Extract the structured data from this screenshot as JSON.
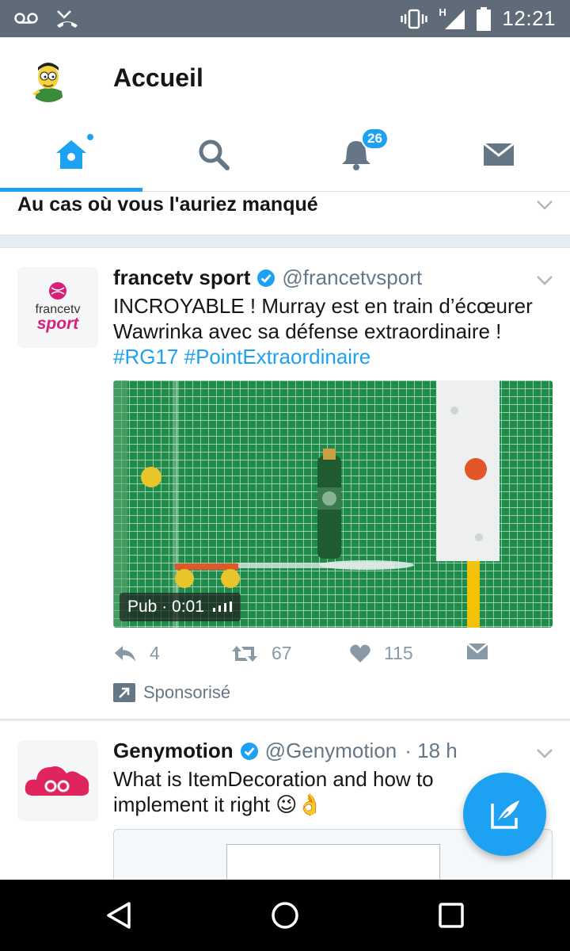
{
  "status_bar": {
    "time": "12:21",
    "network": "H",
    "icons": [
      "voicemail-icon",
      "missed-call-icon",
      "vibrate-icon",
      "signal-icon",
      "battery-icon"
    ]
  },
  "header": {
    "title": "Accueil",
    "tabs": [
      {
        "name": "home",
        "icon": "home-icon",
        "active": true
      },
      {
        "name": "search",
        "icon": "search-icon",
        "active": false
      },
      {
        "name": "notifications",
        "icon": "bell-icon",
        "badge": "26",
        "active": false
      },
      {
        "name": "messages",
        "icon": "envelope-icon",
        "active": false
      }
    ]
  },
  "missed_section": {
    "title": "Au cas où vous l'auriez manqué"
  },
  "tweets": [
    {
      "name": "francetv sport",
      "handle": "@francetvsport",
      "avatar_text_top": "francetv",
      "avatar_text_bottom": "sport",
      "text": "INCROYABLE ! Murray est en train d’écœurer Wawrinka avec sa défense extraordinaire !",
      "hashtags": "#RG17 #PointExtraordinaire",
      "media_label": "Pub · 0:01",
      "replies": "4",
      "retweets": "67",
      "likes": "115",
      "sponsored_label": "Sponsorisé"
    },
    {
      "name": "Genymotion",
      "handle": "@Genymotion",
      "time": "· 18 h",
      "text": "What is ItemDecoration and how to implement it right",
      "emoji": "😉👌"
    }
  ],
  "colors": {
    "accent": "#1da1f2",
    "status_bar": "#5f6b78",
    "secondary_text": "#657786",
    "background": "#e6ecf0"
  }
}
